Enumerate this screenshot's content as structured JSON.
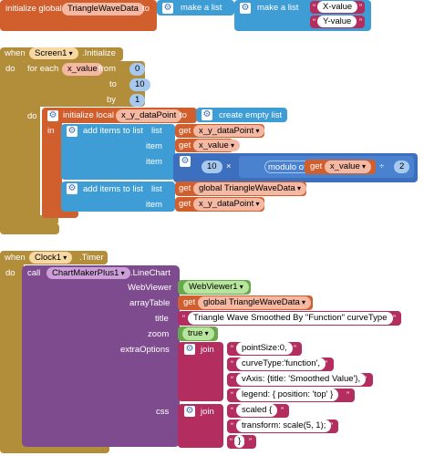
{
  "global_block": {
    "initialize_global": "initialize global",
    "var_name": "TriangleWaveData",
    "to": "to",
    "make_list_1": "make a list",
    "make_list_2": "make a list",
    "x_value": "X-value",
    "y_value": "Y-value"
  },
  "screen_event": {
    "when": "when",
    "component": "Screen1",
    "event": ".Initialize",
    "do": "do",
    "for_each": "for each",
    "loop_var": "x_value",
    "from": "from",
    "from_val": "0",
    "to": "to",
    "to_val": "10",
    "by": "by",
    "by_val": "1",
    "do2": "do",
    "init_local": "initialize local",
    "local_var": "x_y_dataPoint",
    "local_to": "to",
    "create_empty_list": "create empty list",
    "in": "in",
    "add_items_1": "add items to list",
    "list_1": "list",
    "get": "get",
    "get_local_1": "x_y_dataPoint",
    "item_1": "item",
    "get_x_value": "x_value",
    "item_2": "item",
    "num_10": "10",
    "times": "×",
    "modulo_of": "modulo of",
    "get_x_value_2": "x_value",
    "divide": "÷",
    "num_2": "2",
    "add_items_2": "add items to list",
    "list_2": "list",
    "get_global": "global TriangleWaveData",
    "item_3": "item",
    "get_local_2": "x_y_dataPoint"
  },
  "clock_event": {
    "when": "when",
    "component": "Clock1",
    "event": ".Timer",
    "do": "do",
    "call": "call",
    "chart_component": "ChartMakerPlus1",
    "method": ".LineChart",
    "webviewer_label": "WebViewer",
    "webviewer_value": "WebViewer1",
    "arraytable_label": "arrayTable",
    "arraytable_value": "global TriangleWaveData",
    "title_label": "title",
    "title_value": "Triangle Wave Smoothed By \"Function\" curveType",
    "zoom_label": "zoom",
    "zoom_value": "true",
    "extra_label": "extraOptions",
    "join_1": "join",
    "extra_1": "pointSize:0,",
    "extra_2": "curveType:'function',",
    "extra_3": "vAxis: {title: 'Smoothed Value'},",
    "extra_4": "legend: { position: 'top' }",
    "css_label": "css",
    "join_2": "join",
    "css_1": "scaled {",
    "css_2": "transform: scale(5, 1);",
    "css_3": "}"
  },
  "colors": {
    "variables": "#d05f2d",
    "control": "#b28d3a",
    "lists": "#3f9dd6",
    "math": "#3d6fbf",
    "text": "#b32d5e",
    "component": "#7e4c8e",
    "logic": "#6aa84f"
  }
}
